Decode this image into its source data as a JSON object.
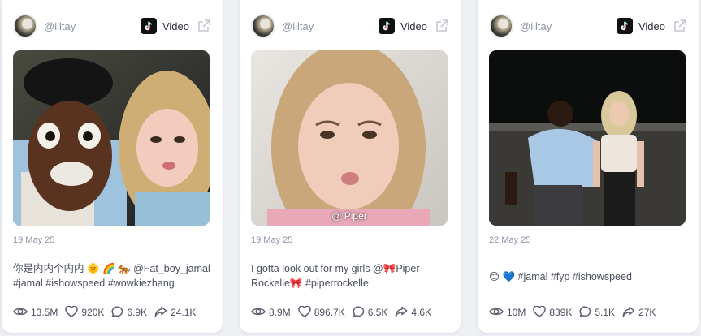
{
  "cards": [
    {
      "handle": "@iiltay",
      "platform": "Video",
      "date": "19 May 25",
      "description": "你是内内个内内 🌞 🌈 🐅 @Fat_boy_jamal #jamal #ishowspeed #wowkiezhang",
      "overlay": "",
      "stats": {
        "views": "13.5M",
        "likes": "920K",
        "comments": "6.9K",
        "shares": "24.1K"
      }
    },
    {
      "handle": "@iiltay",
      "platform": "Video",
      "date": "19 May 25",
      "description": "I gotta look out for my girls @🎀Piper Rockelle🎀 #piperrockelle",
      "overlay": "@ Piper",
      "stats": {
        "views": "8.9M",
        "likes": "896.7K",
        "comments": "6.5K",
        "shares": "4.6K"
      }
    },
    {
      "handle": "@iiltay",
      "platform": "Video",
      "date": "22 May 25",
      "description": "😊 💙 #jamal #fyp #ishowspeed",
      "overlay": "",
      "stats": {
        "views": "10M",
        "likes": "839K",
        "comments": "5.1K",
        "shares": "27K"
      }
    }
  ],
  "icons": {
    "platform": "tiktok-icon",
    "external": "external-link-icon",
    "views": "eye-icon",
    "likes": "heart-icon",
    "comments": "comment-icon",
    "shares": "share-icon"
  },
  "colors": {
    "background": "#eef0f4",
    "card": "#ffffff",
    "muted_text": "#8e94a3",
    "body_text": "#4a4f5c"
  }
}
